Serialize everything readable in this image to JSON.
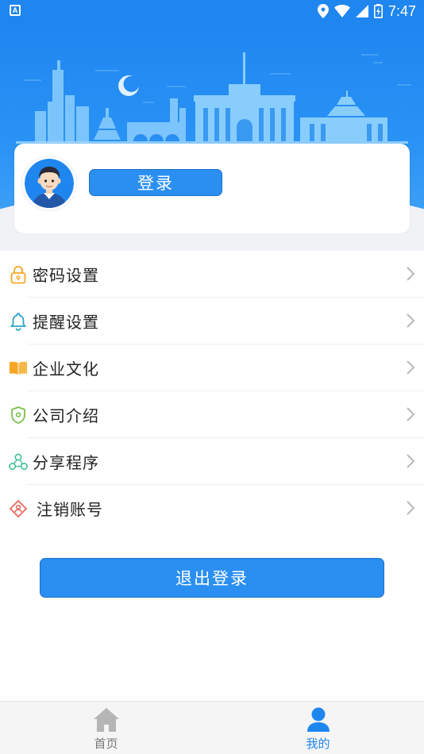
{
  "status_bar": {
    "time": "7:47",
    "app_icon": "a-letter-icon",
    "icons": [
      "location-icon",
      "wifi-icon",
      "signal-icon",
      "battery-icon"
    ]
  },
  "profile": {
    "login_label": "登录",
    "avatar_icon": "user-avatar-icon"
  },
  "menu": {
    "items": [
      {
        "label": "密码设置",
        "icon": "lock-icon",
        "color": "#f5a623"
      },
      {
        "label": "提醒设置",
        "icon": "bell-icon",
        "color": "#2aa7c9"
      },
      {
        "label": "企业文化",
        "icon": "book-icon",
        "color": "#f5a623"
      },
      {
        "label": "公司介绍",
        "icon": "shield-icon",
        "color": "#7cc04b"
      },
      {
        "label": "分享程序",
        "icon": "share-icon",
        "color": "#3fbf8f"
      },
      {
        "label": "注销账号",
        "icon": "user-diamond-icon",
        "color": "#e8655a"
      }
    ]
  },
  "logout_label": "退出登录",
  "tabbar": {
    "tabs": [
      {
        "label": "首页",
        "icon": "home-icon",
        "active": false
      },
      {
        "label": "我的",
        "icon": "user-icon",
        "active": true
      }
    ]
  },
  "colors": {
    "primary": "#1f86f0",
    "button": "#2b8ff1",
    "background_gray": "#f1f2f6"
  }
}
